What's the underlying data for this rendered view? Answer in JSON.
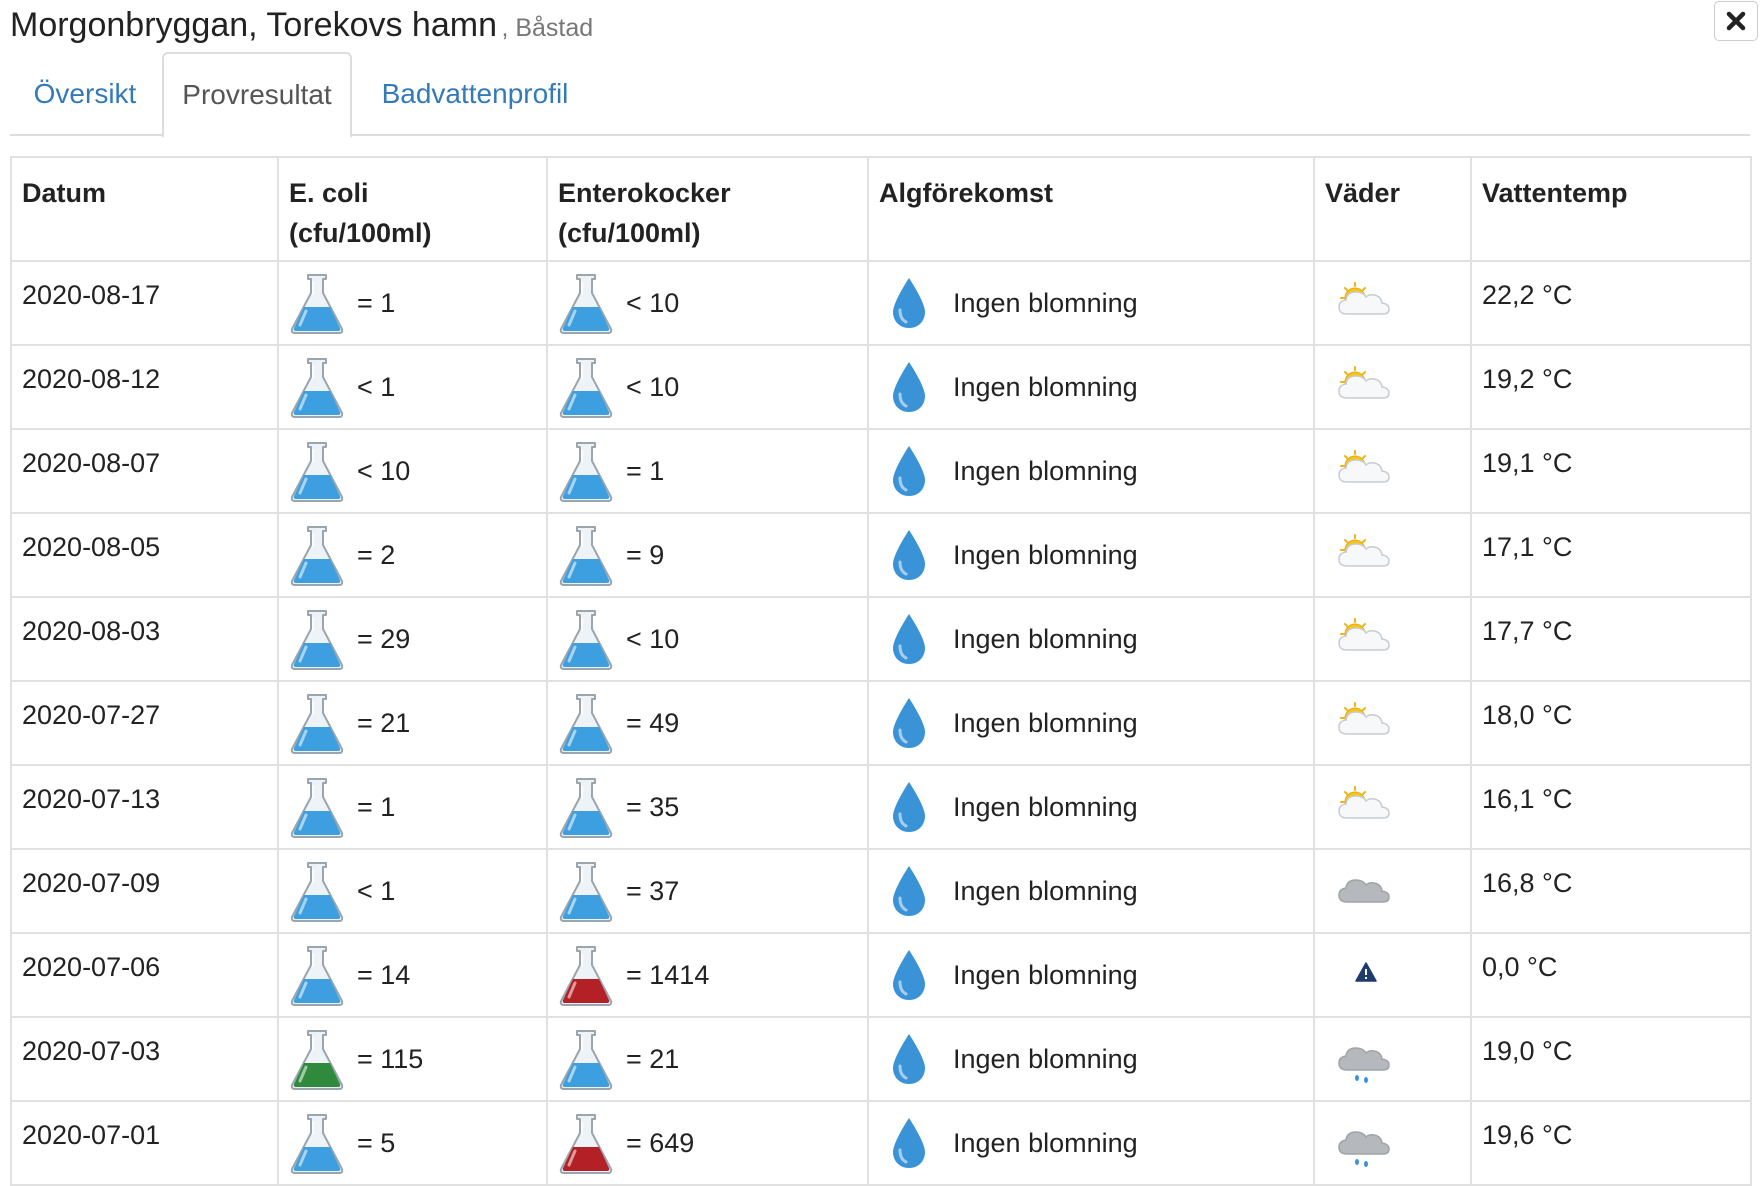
{
  "header": {
    "title": "Morgonbryggan, Torekovs hamn",
    "subtitle": ", Båstad"
  },
  "tabs": [
    {
      "label": "Översikt",
      "active": false
    },
    {
      "label": "Provresultat",
      "active": true
    },
    {
      "label": "Badvattenprofil",
      "active": false
    }
  ],
  "table": {
    "headers": {
      "date": "Datum",
      "ecoli_1": "E. coli",
      "ecoli_2": "(cfu/100ml)",
      "entero_1": "Enterokocker",
      "entero_2": "(cfu/100ml)",
      "algae": "Algförekomst",
      "weather": "Väder",
      "temp": "Vattentemp"
    },
    "rows": [
      {
        "date": "2020-08-17",
        "ecoli": "= 1",
        "ecoli_status": "good",
        "entero": "< 10",
        "entero_status": "good",
        "algae": "Ingen blomning",
        "weather": "partly-cloudy",
        "temp": "22,2 °C"
      },
      {
        "date": "2020-08-12",
        "ecoli": "< 1",
        "ecoli_status": "good",
        "entero": "< 10",
        "entero_status": "good",
        "algae": "Ingen blomning",
        "weather": "partly-cloudy",
        "temp": "19,2 °C"
      },
      {
        "date": "2020-08-07",
        "ecoli": "< 10",
        "ecoli_status": "good",
        "entero": "= 1",
        "entero_status": "good",
        "algae": "Ingen blomning",
        "weather": "partly-cloudy",
        "temp": "19,1 °C"
      },
      {
        "date": "2020-08-05",
        "ecoli": "= 2",
        "ecoli_status": "good",
        "entero": "= 9",
        "entero_status": "good",
        "algae": "Ingen blomning",
        "weather": "partly-cloudy",
        "temp": "17,1 °C"
      },
      {
        "date": "2020-08-03",
        "ecoli": "= 29",
        "ecoli_status": "good",
        "entero": "< 10",
        "entero_status": "good",
        "algae": "Ingen blomning",
        "weather": "partly-cloudy",
        "temp": "17,7 °C"
      },
      {
        "date": "2020-07-27",
        "ecoli": "= 21",
        "ecoli_status": "good",
        "entero": "= 49",
        "entero_status": "good",
        "algae": "Ingen blomning",
        "weather": "partly-cloudy",
        "temp": "18,0 °C"
      },
      {
        "date": "2020-07-13",
        "ecoli": "= 1",
        "ecoli_status": "good",
        "entero": "= 35",
        "entero_status": "good",
        "algae": "Ingen blomning",
        "weather": "partly-cloudy",
        "temp": "16,1 °C"
      },
      {
        "date": "2020-07-09",
        "ecoli": "< 1",
        "ecoli_status": "good",
        "entero": "= 37",
        "entero_status": "good",
        "algae": "Ingen blomning",
        "weather": "cloudy",
        "temp": "16,8 °C"
      },
      {
        "date": "2020-07-06",
        "ecoli": "= 14",
        "ecoli_status": "good",
        "entero": "= 1414",
        "entero_status": "bad",
        "algae": "Ingen blomning",
        "weather": "warning",
        "temp": "0,0 °C"
      },
      {
        "date": "2020-07-03",
        "ecoli": "= 115",
        "ecoli_status": "ok",
        "entero": "= 21",
        "entero_status": "good",
        "algae": "Ingen blomning",
        "weather": "rain",
        "temp": "19,0 °C"
      },
      {
        "date": "2020-07-01",
        "ecoli": "= 5",
        "ecoli_status": "good",
        "entero": "= 649",
        "entero_status": "bad",
        "algae": "Ingen blomning",
        "weather": "rain",
        "temp": "19,6 °C"
      }
    ]
  },
  "colors": {
    "link": "#337ab7",
    "flask_good": "#3e9fe0",
    "flask_ok": "#2f8a3e",
    "flask_bad": "#b32025",
    "drop": "#3a93d6",
    "warning": "#1d3b6e"
  }
}
